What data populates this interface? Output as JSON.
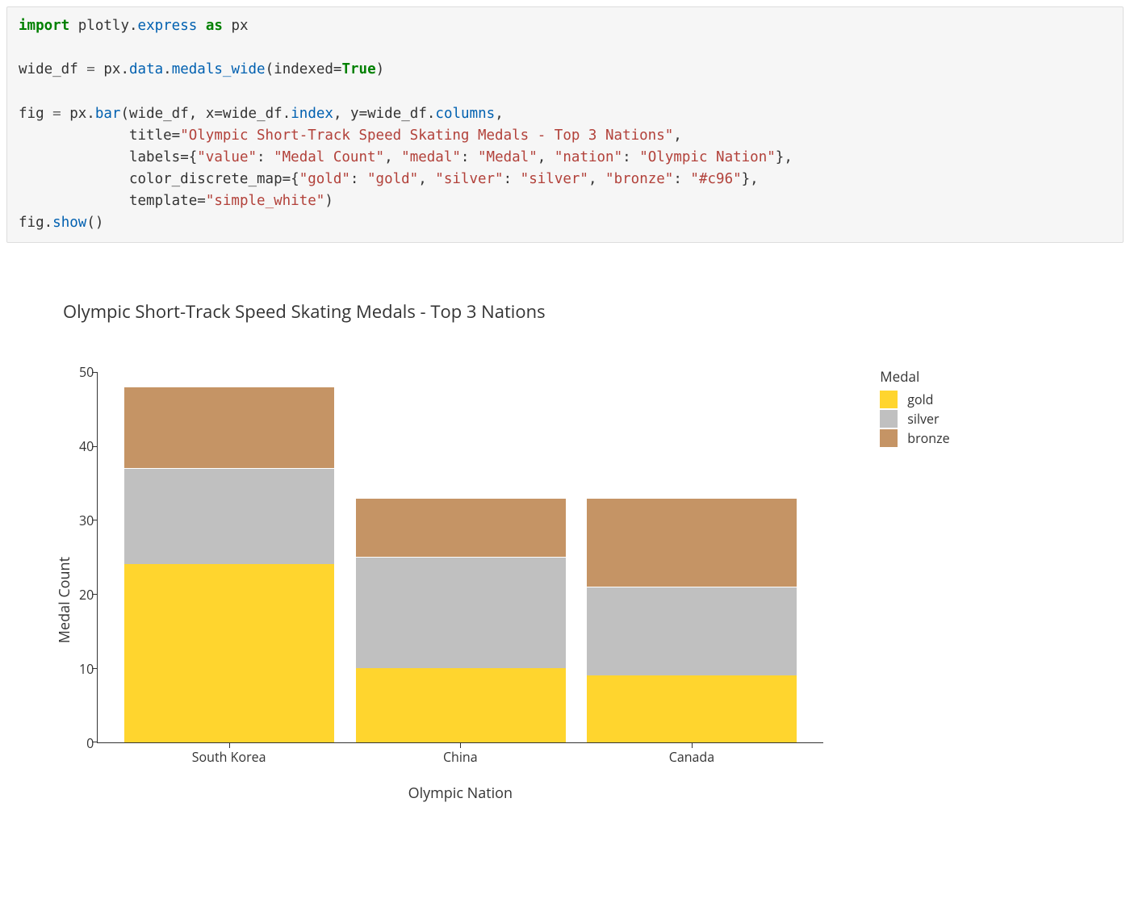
{
  "code": {
    "line1_import": "import",
    "line1_mod": "plotly",
    "line1_dot": ".",
    "line1_sub": "express",
    "line1_as": "as",
    "line1_alias": "px",
    "line3_var": "wide_df",
    "line3_eq": " = ",
    "line3_px": "px",
    "line3_data": "data",
    "line3_fn": "medals_wide",
    "line3_argk": "indexed",
    "line3_argv": "True",
    "line5_var": "fig",
    "line5_eq": " = ",
    "line5_px": "px",
    "line5_fn": "bar",
    "line5_arg1": "wide_df",
    "line5_xk": "x",
    "line5_xv1": "wide_df",
    "line5_xv2": "index",
    "line5_yk": "y",
    "line5_yv1": "wide_df",
    "line5_yv2": "columns",
    "line6_titlek": "title",
    "line6_titlev": "\"Olympic Short-Track Speed Skating Medals - Top 3 Nations\"",
    "line7_labelsk": "labels",
    "line7_k1": "\"value\"",
    "line7_v1": "\"Medal Count\"",
    "line7_k2": "\"medal\"",
    "line7_v2": "\"Medal\"",
    "line7_k3": "\"nation\"",
    "line7_v3": "\"Olympic Nation\"",
    "line8_cdmk": "color_discrete_map",
    "line8_k1": "\"gold\"",
    "line8_v1": "\"gold\"",
    "line8_k2": "\"silver\"",
    "line8_v2": "\"silver\"",
    "line8_k3": "\"bronze\"",
    "line8_v3": "\"#c96\"",
    "line9_tmpk": "template",
    "line9_tmpv": "\"simple_white\"",
    "line10_obj": "fig",
    "line10_fn": "show"
  },
  "chart_data": {
    "type": "bar",
    "stacked": true,
    "title": "Olympic Short-Track Speed Skating Medals - Top 3 Nations",
    "xlabel": "Olympic Nation",
    "ylabel": "Medal Count",
    "ylim": [
      0,
      50
    ],
    "yticks": [
      0,
      10,
      20,
      30,
      40,
      50
    ],
    "categories": [
      "South Korea",
      "China",
      "Canada"
    ],
    "series": [
      {
        "name": "gold",
        "color": "#ffd52e",
        "values": [
          24,
          10,
          9
        ]
      },
      {
        "name": "silver",
        "color": "#c0c0c0",
        "values": [
          13,
          15,
          12
        ]
      },
      {
        "name": "bronze",
        "color": "#c59465",
        "values": [
          11,
          8,
          12
        ]
      }
    ],
    "legend_title": "Medal",
    "legend": [
      "gold",
      "silver",
      "bronze"
    ]
  }
}
